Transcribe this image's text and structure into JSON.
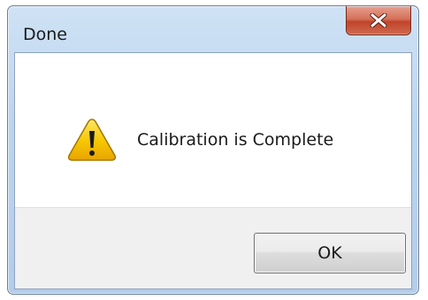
{
  "window": {
    "title": "Done"
  },
  "titlebar": {
    "close_icon": "close-x-icon"
  },
  "message": {
    "icon": "warning-icon",
    "text": "Calibration is Complete"
  },
  "buttons": {
    "ok_label": "OK"
  },
  "colors": {
    "close_button": "#c7432b",
    "warning_fill": "#f5c400",
    "titlebar": "#bcd5ee",
    "footer": "#f0f0f0"
  }
}
